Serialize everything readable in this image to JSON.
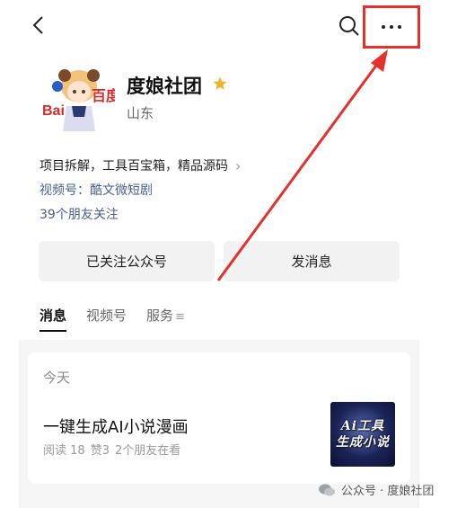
{
  "account": {
    "name": "度娘社团",
    "region": "山东",
    "description": "项目拆解，工具百宝箱，精品源码",
    "video_link": "视频号：酷文微短剧",
    "friends_follow": "39个朋友关注",
    "avatar_text": "百度"
  },
  "actions": {
    "followed_label": "已关注公众号",
    "message_label": "发消息"
  },
  "tabs": [
    {
      "label": "消息",
      "active": true
    },
    {
      "label": "视频号",
      "active": false
    },
    {
      "label": "服务",
      "active": false
    }
  ],
  "feed": {
    "date_label": "今天",
    "article": {
      "title": "一键生成AI小说漫画",
      "reads": "阅读 18",
      "likes": "赞3",
      "friends_viewing": "2个朋友在看",
      "thumb_line1": "Ai工具",
      "thumb_line2": "生成小说"
    }
  },
  "watermark": "公众号 · 度娘社团",
  "colors": {
    "highlight_red": "#e4312b",
    "link_blue": "#4a5f8d",
    "star_gold": "#f0b429"
  }
}
